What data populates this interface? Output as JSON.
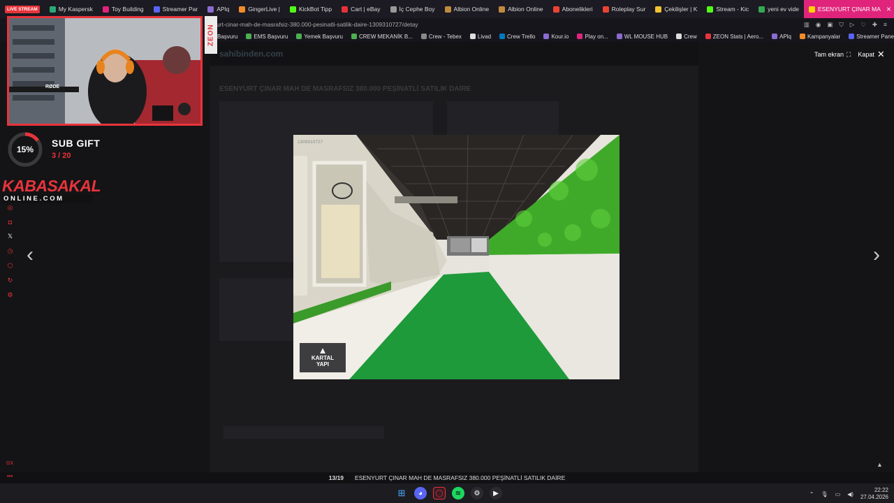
{
  "browser": {
    "tabs": [
      {
        "label": "LIVE STREAM",
        "badge": true,
        "color": "#e8343b"
      },
      {
        "label": "My Kaspersk",
        "color": "#2aa876"
      },
      {
        "label": "Toy Building",
        "color": "#e0247c"
      },
      {
        "label": "Streamer Par",
        "color": "#5865f2"
      },
      {
        "label": "APlq",
        "color": "#8a6bd1"
      },
      {
        "label": "GingerLive |",
        "color": "#f28c28"
      },
      {
        "label": "KickBot Tipp",
        "color": "#53fc18"
      },
      {
        "label": "Cart | eBay",
        "color": "#e53238"
      },
      {
        "label": "İç Cephe Boy",
        "color": "#999999"
      },
      {
        "label": "Albion Online",
        "color": "#c08a3e"
      },
      {
        "label": "Albion Online",
        "color": "#c08a3e"
      },
      {
        "label": "Abonelikleri",
        "color": "#ea4335"
      },
      {
        "label": "Roleplay Sur",
        "color": "#ea4335"
      },
      {
        "label": "Çekilişler | K",
        "color": "#f2c230"
      },
      {
        "label": "Stream - Kic",
        "color": "#53fc18"
      },
      {
        "label": "yeni ev vide",
        "color": "#34a853"
      },
      {
        "label": "ESENYURT ÇINAR MA",
        "color": "#ffd400",
        "active": true
      }
    ],
    "address": "urt-cinar-mah-de-masrafsiz-380.000-pesinatli-satilik-daire-1309310727/detay",
    "bookmarks": [
      {
        "label": "Başvuru",
        "color": "#4caf50"
      },
      {
        "label": "EMS Başvuru",
        "color": "#4caf50"
      },
      {
        "label": "Yemek Başvuru",
        "color": "#4caf50"
      },
      {
        "label": "CREW MEKANİK B...",
        "color": "#4caf50"
      },
      {
        "label": "Crew - Tebex",
        "color": "#888888"
      },
      {
        "label": "Livad",
        "color": "#dddddd"
      },
      {
        "label": "Crew Trello",
        "color": "#0079bf"
      },
      {
        "label": "Kour.io",
        "color": "#8a6bd1"
      },
      {
        "label": "Play on...",
        "color": "#e0247c"
      },
      {
        "label": "WL MOUSE HUB",
        "color": "#8a6bd1"
      },
      {
        "label": "Crew",
        "color": "#dddddd"
      },
      {
        "label": "ZEON Stats | Aero...",
        "color": "#e8343b"
      },
      {
        "label": "APlq",
        "color": "#8a6bd1"
      },
      {
        "label": "Kampanyalar",
        "color": "#f28c28"
      },
      {
        "label": "Streamer Panel",
        "color": "#5865f2"
      }
    ]
  },
  "site": {
    "logo": "sahibinden.com",
    "listing_title": "ESENYURT ÇINAR MAH DE MASRAFSIZ 380.000 PEŞİNATLİ SATILIK DAİRE"
  },
  "gallery": {
    "fullscreen_label": "Tam ekran",
    "close_label": "Kapat",
    "prev": "‹",
    "next": "›",
    "counter": "13/19",
    "caption": "ESENYURT ÇINAR MAH DE MASRAFSIZ 380.000 PEŞİNATLİ SATILIK DAİRE",
    "watermark_id": "1309310727",
    "brand_top": "KARTAL",
    "brand_bottom": "YAPI"
  },
  "stream_overlay": {
    "sponsor": "ZEON",
    "goal_percent": "15%",
    "goal_progress": 0.15,
    "goal_title": "SUB GIFT",
    "goal_count": "3 / 20",
    "brand_line1": "KABASAKAL",
    "brand_line2": "ONLINE.COM",
    "mic_brand": "RØDE",
    "gx": "GX"
  },
  "taskbar": {
    "time": "22:22",
    "date": "27.04.2026"
  },
  "colors": {
    "accent": "#e8343b",
    "tab_active": "#e0247c"
  }
}
